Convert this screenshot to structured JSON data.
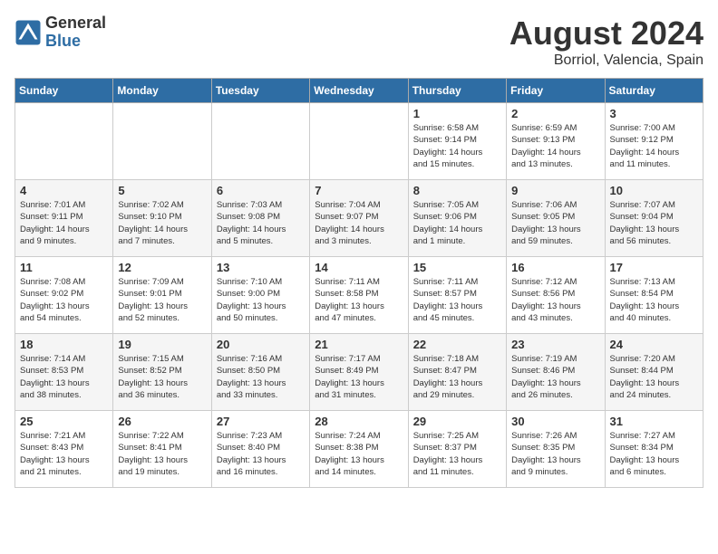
{
  "header": {
    "logo_line1": "General",
    "logo_line2": "Blue",
    "month_year": "August 2024",
    "location": "Borriol, Valencia, Spain"
  },
  "days_of_week": [
    "Sunday",
    "Monday",
    "Tuesday",
    "Wednesday",
    "Thursday",
    "Friday",
    "Saturday"
  ],
  "weeks": [
    [
      {
        "day": "",
        "content": ""
      },
      {
        "day": "",
        "content": ""
      },
      {
        "day": "",
        "content": ""
      },
      {
        "day": "",
        "content": ""
      },
      {
        "day": "1",
        "content": "Sunrise: 6:58 AM\nSunset: 9:14 PM\nDaylight: 14 hours\nand 15 minutes."
      },
      {
        "day": "2",
        "content": "Sunrise: 6:59 AM\nSunset: 9:13 PM\nDaylight: 14 hours\nand 13 minutes."
      },
      {
        "day": "3",
        "content": "Sunrise: 7:00 AM\nSunset: 9:12 PM\nDaylight: 14 hours\nand 11 minutes."
      }
    ],
    [
      {
        "day": "4",
        "content": "Sunrise: 7:01 AM\nSunset: 9:11 PM\nDaylight: 14 hours\nand 9 minutes."
      },
      {
        "day": "5",
        "content": "Sunrise: 7:02 AM\nSunset: 9:10 PM\nDaylight: 14 hours\nand 7 minutes."
      },
      {
        "day": "6",
        "content": "Sunrise: 7:03 AM\nSunset: 9:08 PM\nDaylight: 14 hours\nand 5 minutes."
      },
      {
        "day": "7",
        "content": "Sunrise: 7:04 AM\nSunset: 9:07 PM\nDaylight: 14 hours\nand 3 minutes."
      },
      {
        "day": "8",
        "content": "Sunrise: 7:05 AM\nSunset: 9:06 PM\nDaylight: 14 hours\nand 1 minute."
      },
      {
        "day": "9",
        "content": "Sunrise: 7:06 AM\nSunset: 9:05 PM\nDaylight: 13 hours\nand 59 minutes."
      },
      {
        "day": "10",
        "content": "Sunrise: 7:07 AM\nSunset: 9:04 PM\nDaylight: 13 hours\nand 56 minutes."
      }
    ],
    [
      {
        "day": "11",
        "content": "Sunrise: 7:08 AM\nSunset: 9:02 PM\nDaylight: 13 hours\nand 54 minutes."
      },
      {
        "day": "12",
        "content": "Sunrise: 7:09 AM\nSunset: 9:01 PM\nDaylight: 13 hours\nand 52 minutes."
      },
      {
        "day": "13",
        "content": "Sunrise: 7:10 AM\nSunset: 9:00 PM\nDaylight: 13 hours\nand 50 minutes."
      },
      {
        "day": "14",
        "content": "Sunrise: 7:11 AM\nSunset: 8:58 PM\nDaylight: 13 hours\nand 47 minutes."
      },
      {
        "day": "15",
        "content": "Sunrise: 7:11 AM\nSunset: 8:57 PM\nDaylight: 13 hours\nand 45 minutes."
      },
      {
        "day": "16",
        "content": "Sunrise: 7:12 AM\nSunset: 8:56 PM\nDaylight: 13 hours\nand 43 minutes."
      },
      {
        "day": "17",
        "content": "Sunrise: 7:13 AM\nSunset: 8:54 PM\nDaylight: 13 hours\nand 40 minutes."
      }
    ],
    [
      {
        "day": "18",
        "content": "Sunrise: 7:14 AM\nSunset: 8:53 PM\nDaylight: 13 hours\nand 38 minutes."
      },
      {
        "day": "19",
        "content": "Sunrise: 7:15 AM\nSunset: 8:52 PM\nDaylight: 13 hours\nand 36 minutes."
      },
      {
        "day": "20",
        "content": "Sunrise: 7:16 AM\nSunset: 8:50 PM\nDaylight: 13 hours\nand 33 minutes."
      },
      {
        "day": "21",
        "content": "Sunrise: 7:17 AM\nSunset: 8:49 PM\nDaylight: 13 hours\nand 31 minutes."
      },
      {
        "day": "22",
        "content": "Sunrise: 7:18 AM\nSunset: 8:47 PM\nDaylight: 13 hours\nand 29 minutes."
      },
      {
        "day": "23",
        "content": "Sunrise: 7:19 AM\nSunset: 8:46 PM\nDaylight: 13 hours\nand 26 minutes."
      },
      {
        "day": "24",
        "content": "Sunrise: 7:20 AM\nSunset: 8:44 PM\nDaylight: 13 hours\nand 24 minutes."
      }
    ],
    [
      {
        "day": "25",
        "content": "Sunrise: 7:21 AM\nSunset: 8:43 PM\nDaylight: 13 hours\nand 21 minutes."
      },
      {
        "day": "26",
        "content": "Sunrise: 7:22 AM\nSunset: 8:41 PM\nDaylight: 13 hours\nand 19 minutes."
      },
      {
        "day": "27",
        "content": "Sunrise: 7:23 AM\nSunset: 8:40 PM\nDaylight: 13 hours\nand 16 minutes."
      },
      {
        "day": "28",
        "content": "Sunrise: 7:24 AM\nSunset: 8:38 PM\nDaylight: 13 hours\nand 14 minutes."
      },
      {
        "day": "29",
        "content": "Sunrise: 7:25 AM\nSunset: 8:37 PM\nDaylight: 13 hours\nand 11 minutes."
      },
      {
        "day": "30",
        "content": "Sunrise: 7:26 AM\nSunset: 8:35 PM\nDaylight: 13 hours\nand 9 minutes."
      },
      {
        "day": "31",
        "content": "Sunrise: 7:27 AM\nSunset: 8:34 PM\nDaylight: 13 hours\nand 6 minutes."
      }
    ]
  ]
}
